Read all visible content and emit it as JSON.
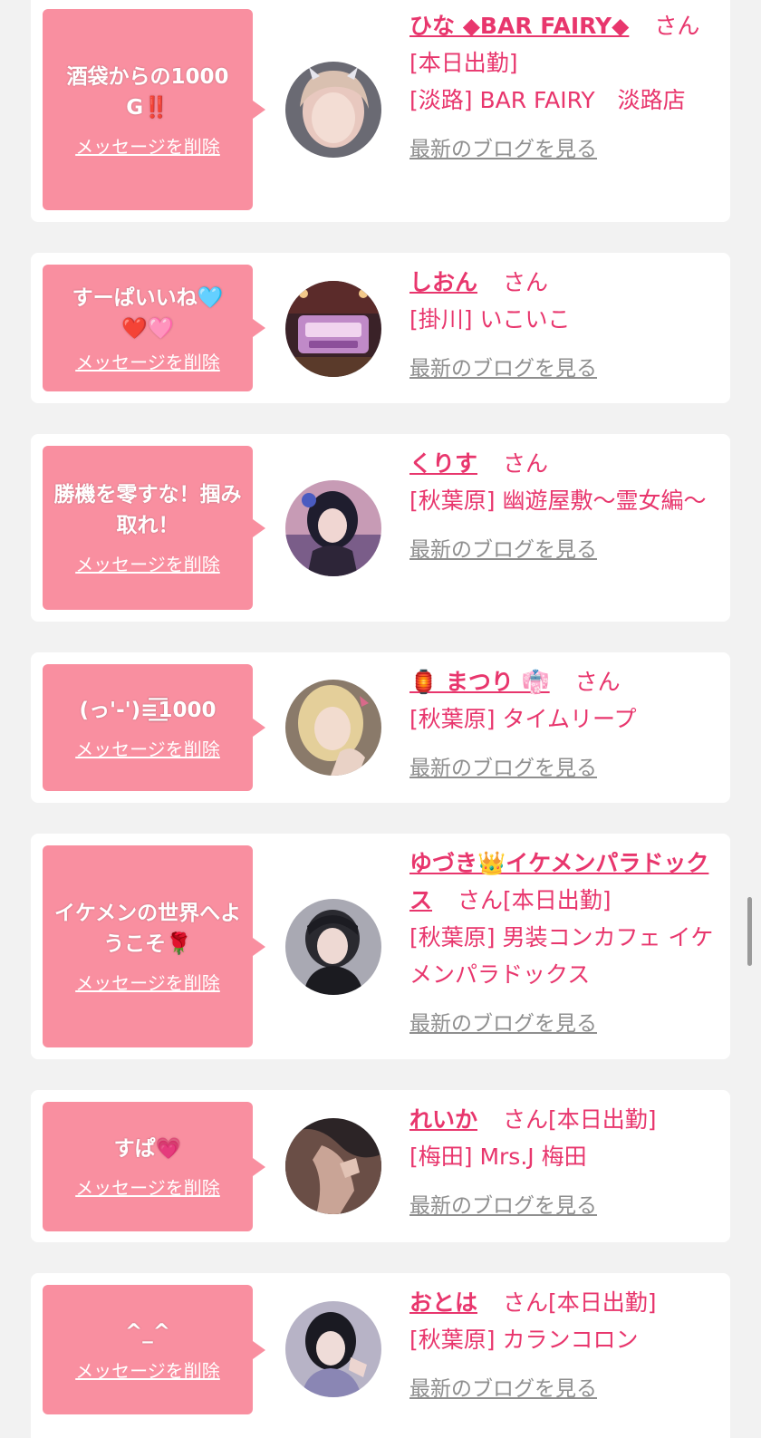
{
  "cards": [
    {
      "message": "酒袋からの1000G‼️",
      "delete_label": "メッセージを削除",
      "name": "ひな ◆BAR FAIRY◆",
      "honorific": "さん",
      "status": "[本日出勤]",
      "shop": "[淡路] BAR FAIRY　淡路店",
      "blog_label": "最新のブログを見る"
    },
    {
      "message": "すーぱいいね🩵❤️🩷",
      "delete_label": "メッセージを削除",
      "name": "しおん",
      "honorific": "さん",
      "status": "",
      "shop": "[掛川] いこいこ",
      "blog_label": "最新のブログを見る"
    },
    {
      "message": "勝機を零すな！掴み取れ！",
      "delete_label": "メッセージを削除",
      "name": "くりす",
      "honorific": "さん",
      "status": "",
      "shop": "[秋葉原] 幽遊屋敷〜霊女編〜",
      "blog_label": "最新のブログを見る"
    },
    {
      "message": "(っ'-')≡͟͟͞͞1000",
      "delete_label": "メッセージを削除",
      "name": "🏮 まつり 👘",
      "honorific": "さん",
      "status": "",
      "shop": "[秋葉原] タイムリープ",
      "blog_label": "最新のブログを見る"
    },
    {
      "message": "イケメンの世界へようこそ🌹",
      "delete_label": "メッセージを削除",
      "name": "ゆづき👑イケメンパラドックス",
      "honorific": "さん",
      "status": "[本日出勤]",
      "shop": "[秋葉原] 男装コンカフェ イケメンパラドックス",
      "blog_label": "最新のブログを見る"
    },
    {
      "message": "すぱ💗",
      "delete_label": "メッセージを削除",
      "name": "れいか",
      "honorific": "さん",
      "status": "[本日出勤]",
      "shop": "[梅田] Mrs.J 梅田",
      "blog_label": "最新のブログを見る"
    },
    {
      "message": "^_^",
      "delete_label": "メッセージを削除",
      "name": "おとは",
      "honorific": "さん",
      "status": "[本日出勤]",
      "shop": "[秋葉原] カランコロン",
      "blog_label": "最新のブログを見る"
    }
  ],
  "colors": {
    "accent": "#e8366d",
    "bubble": "#f98fa0",
    "background": "#f2f2f2",
    "link_gray": "#8f8f8f"
  }
}
